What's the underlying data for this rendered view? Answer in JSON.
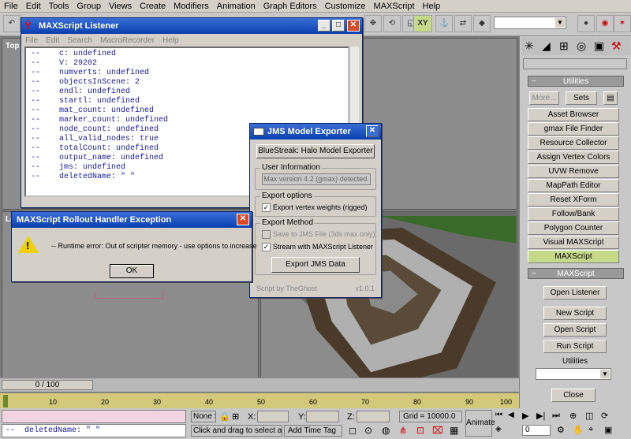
{
  "menubar": [
    "File",
    "Edit",
    "Tools",
    "Group",
    "Views",
    "Create",
    "Modifiers",
    "Animation",
    "Graph Editors",
    "Customize",
    "MAXScript",
    "Help"
  ],
  "toolbar": {
    "view_label": "XY"
  },
  "viewports": {
    "top_label": "Top",
    "left_label": "Le"
  },
  "listener": {
    "title": "MAXScript Listener",
    "menu": [
      "File",
      "Edit",
      "Search",
      "MacroRecorder",
      "Help"
    ],
    "lines": [
      "--    c: undefined",
      "--    V: 29202",
      "--    numverts: undefined",
      "--    objectsInScene: 2",
      "--    endl: undefined",
      "--    startl: undefined",
      "--    mat_count: undefined",
      "--    marker_count: undefined",
      "--    node_count: undefined",
      "--    all_valid_nodes: true",
      "--    totalCount: undefined",
      "--    output_name: undefined",
      "--    jms: undefined",
      "--    deletedName: \" \""
    ]
  },
  "exception": {
    "title": "MAXScript Rollout Handler Exception",
    "message": "-- Runtime error: Out of scripter memory - use options to increase",
    "ok": "OK"
  },
  "jms": {
    "title": "JMS Model Exporter",
    "header_button": "BlueStreak: Halo Model Exporter",
    "user_info_label": "User Information",
    "version_text": "Max version 4.2 (gmax) detected.",
    "export_options_label": "Export options",
    "export_vertex_weights": "Export vertex weights (rigged)",
    "export_method_label": "Export Method",
    "save_to_file": "Save to JMS File (3ds max only)",
    "stream_listener": "Stream with MAXScript Listener",
    "export_button": "Export JMS Data",
    "credit": "Script by TheGhost",
    "version": "v1.0.1"
  },
  "utilities": {
    "header": "Utilities",
    "more": "More...",
    "sets": "Sets",
    "items": [
      "Asset Browser",
      "gmax File Finder",
      "Resource Collector",
      "Assign Vertex Colors",
      "UVW Remove",
      "MapPath Editor",
      "Reset XForm",
      "Follow/Bank",
      "Polygon Counter",
      "Visual MAXScript",
      "MAXScript"
    ]
  },
  "maxscript_rollout": {
    "header": "MAXScript",
    "open_listener": "Open Listener",
    "new_script": "New Script",
    "open_script": "Open Script",
    "run_script": "Run Script",
    "utilities_label": "Utilities",
    "close": "Close"
  },
  "timeline": {
    "frame": "0 / 100",
    "ticks": [
      "10",
      "20",
      "30",
      "40",
      "50",
      "60",
      "70",
      "80",
      "90",
      "100"
    ]
  },
  "status": {
    "listener_line": "--  deletedName: \" \"",
    "none_label": "None S",
    "x": "X:",
    "y": "Y:",
    "z": "Z:",
    "grid": "Grid = 10000.0",
    "hint": "Click and drag to select and m",
    "add_time_tag": "Add Time Tag",
    "animate": "Animate",
    "frame_value": "0"
  },
  "colors": {
    "accent": "#0a3fb0",
    "active": "#c6d98a",
    "timeline": "#d4c87a"
  }
}
